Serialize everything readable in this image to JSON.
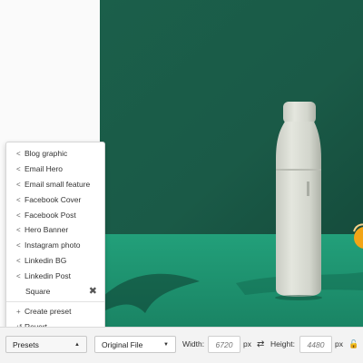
{
  "presets_menu": {
    "items": [
      {
        "label": "Blog graphic",
        "icon": "share-icon"
      },
      {
        "label": "Email Hero",
        "icon": "share-icon"
      },
      {
        "label": "Email small feature",
        "icon": "share-icon"
      },
      {
        "label": "Facebook Cover",
        "icon": "share-icon"
      },
      {
        "label": "Facebook Post",
        "icon": "share-icon"
      },
      {
        "label": "Hero Banner",
        "icon": "share-icon"
      },
      {
        "label": "Instagram photo",
        "icon": "share-icon"
      },
      {
        "label": "Linkedin BG",
        "icon": "share-icon"
      },
      {
        "label": "Linkedin Post",
        "icon": "share-icon"
      },
      {
        "label": "Square",
        "icon": "",
        "removable": true
      }
    ],
    "actions": [
      {
        "label": "Create preset",
        "icon": "plus-icon"
      },
      {
        "label": "Revert",
        "icon": "undo-icon"
      }
    ]
  },
  "toolbar": {
    "presets_label": "Presets",
    "format_selected": "Original File",
    "width_label": "Width:",
    "width_placeholder": "6720",
    "width_unit": "px",
    "height_label": "Height:",
    "height_placeholder": "4480",
    "height_unit": "px"
  },
  "colors": {
    "wall": "#1a5e49",
    "floor": "#1e8f6b",
    "bottle": "#d6d8cf"
  }
}
